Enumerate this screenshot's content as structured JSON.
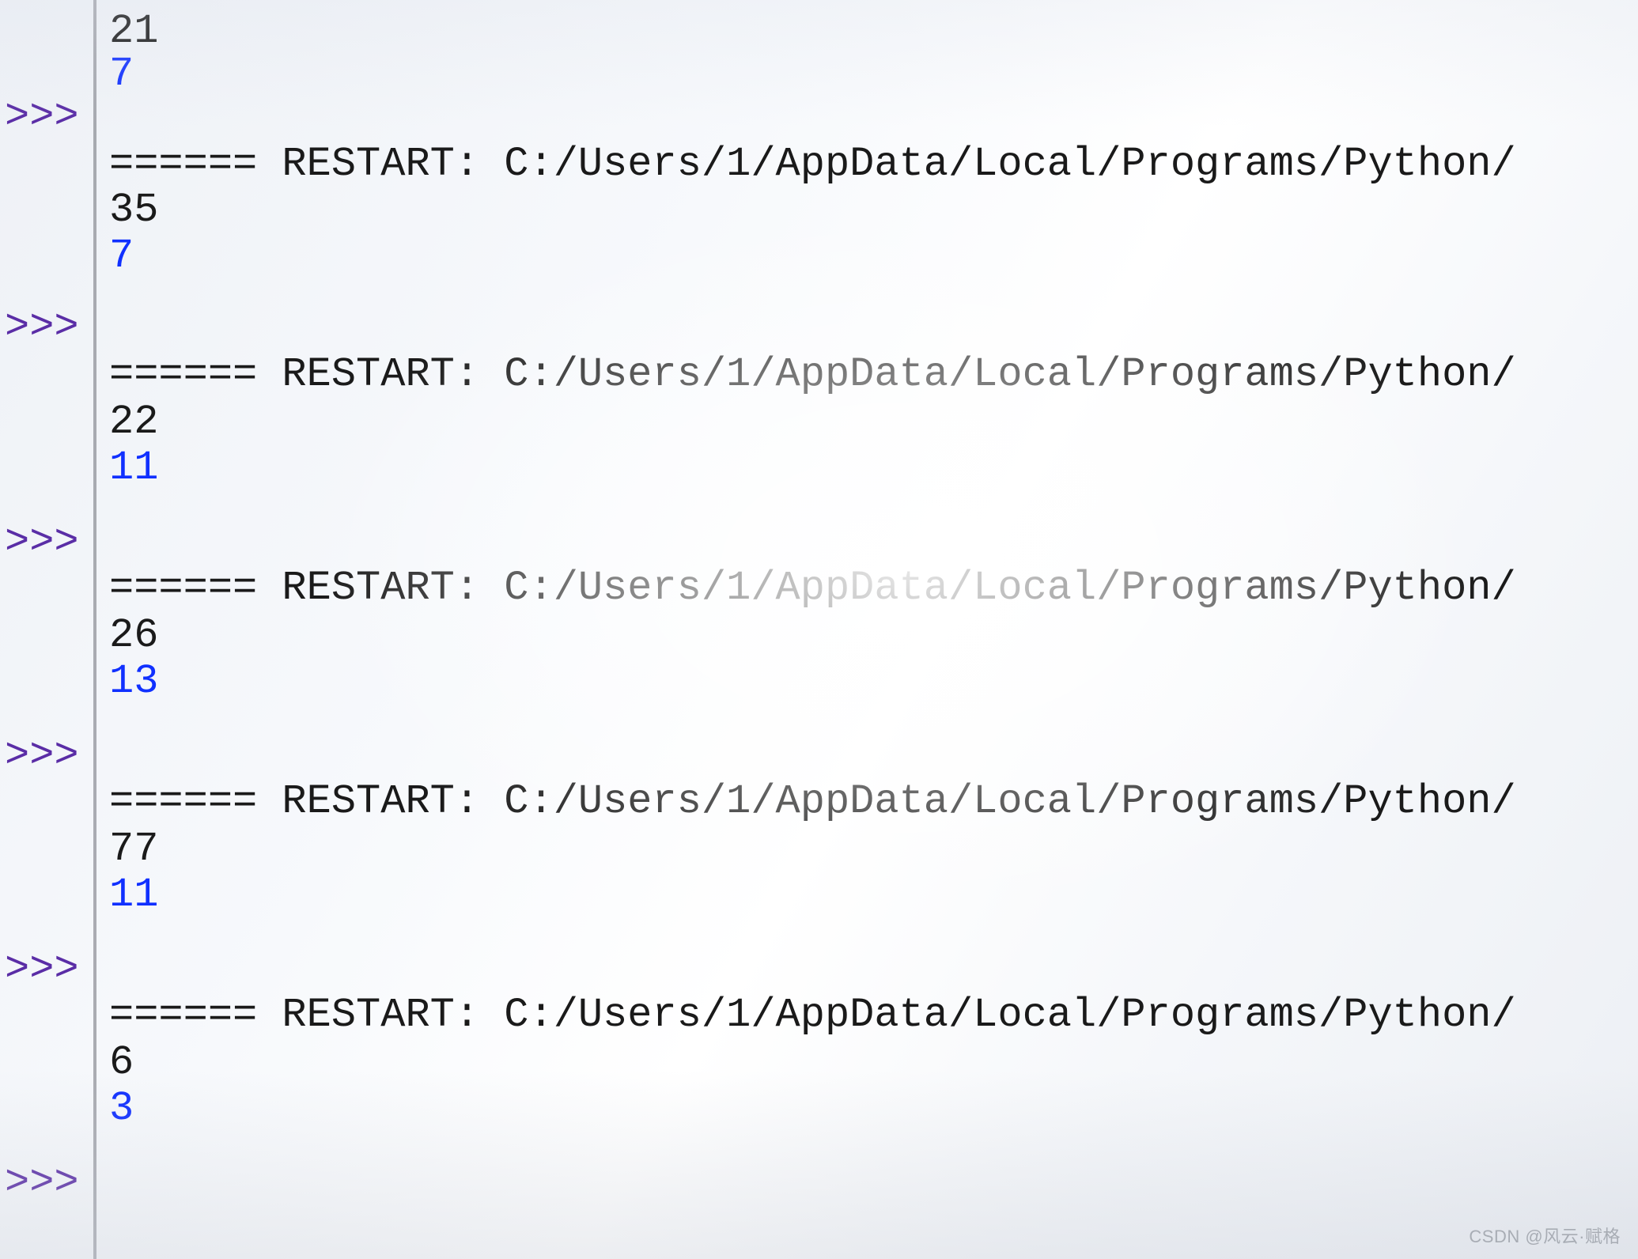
{
  "prompt": ">>>",
  "restart_line": "====== RESTART: C:/Users/1/AppData/Local/Programs/Python/",
  "blocks": [
    {
      "out1": "21",
      "out2": "7"
    },
    {
      "out1": "35",
      "out2": "7"
    },
    {
      "out1": "22",
      "out2": "11"
    },
    {
      "out1": "26",
      "out2": "13"
    },
    {
      "out1": "77",
      "out2": "11"
    },
    {
      "out1": "6",
      "out2": "3"
    }
  ],
  "watermark": "CSDN @风云·赋格"
}
